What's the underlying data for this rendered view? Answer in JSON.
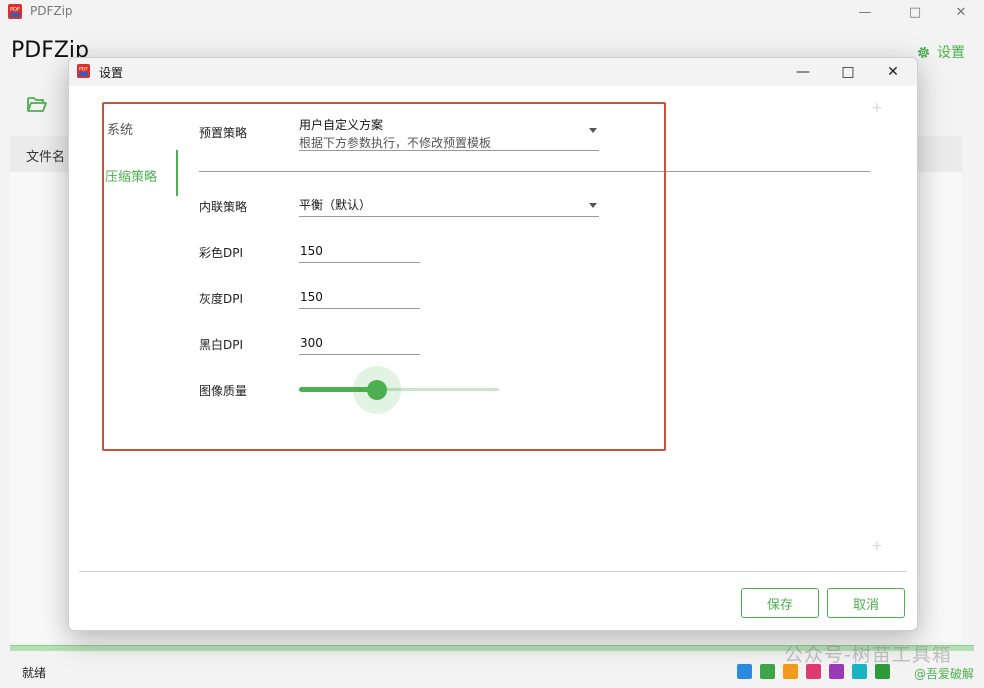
{
  "app": {
    "window_title": "PDFZip",
    "heading": "PDFZip",
    "settings_label": "设置",
    "logo_text": "PDF",
    "table": {
      "col_filename": "文件名"
    },
    "status": "就绪",
    "watermark": "公众号-树苗工具箱",
    "credit": "@吾爱破解",
    "swatch_colors": [
      "#2a8be0",
      "#3fa54a",
      "#f09a1e",
      "#e03a72",
      "#9b3ab8",
      "#19b4c4",
      "#2f9a3a"
    ],
    "accent_color": "#4caf50"
  },
  "icons": {
    "app_logo": "pdf-logo-icon",
    "folder": "folder-open-icon",
    "gear": "gear-icon",
    "minimize": "minimize-icon",
    "maximize": "maximize-icon",
    "close": "close-icon",
    "chevron": "chevron-down-icon"
  },
  "dialog": {
    "title": "设置",
    "nav": [
      {
        "label": "系统",
        "active": false
      },
      {
        "label": "压缩策略",
        "active": true
      }
    ],
    "preset": {
      "label": "预置策略",
      "value": "用户自定义方案",
      "description": "根据下方参数执行，不修改预置模板"
    },
    "inline": {
      "label": "内联策略",
      "value": "平衡（默认）"
    },
    "color_dpi": {
      "label": "彩色DPI",
      "value": "150"
    },
    "gray_dpi": {
      "label": "灰度DPI",
      "value": "150"
    },
    "mono_dpi": {
      "label": "黑白DPI",
      "value": "300"
    },
    "image_quality": {
      "label": "图像质量",
      "level": 0.39
    },
    "buttons": {
      "save": "保存",
      "cancel": "取消"
    },
    "highlight_color": "#c7533c"
  }
}
